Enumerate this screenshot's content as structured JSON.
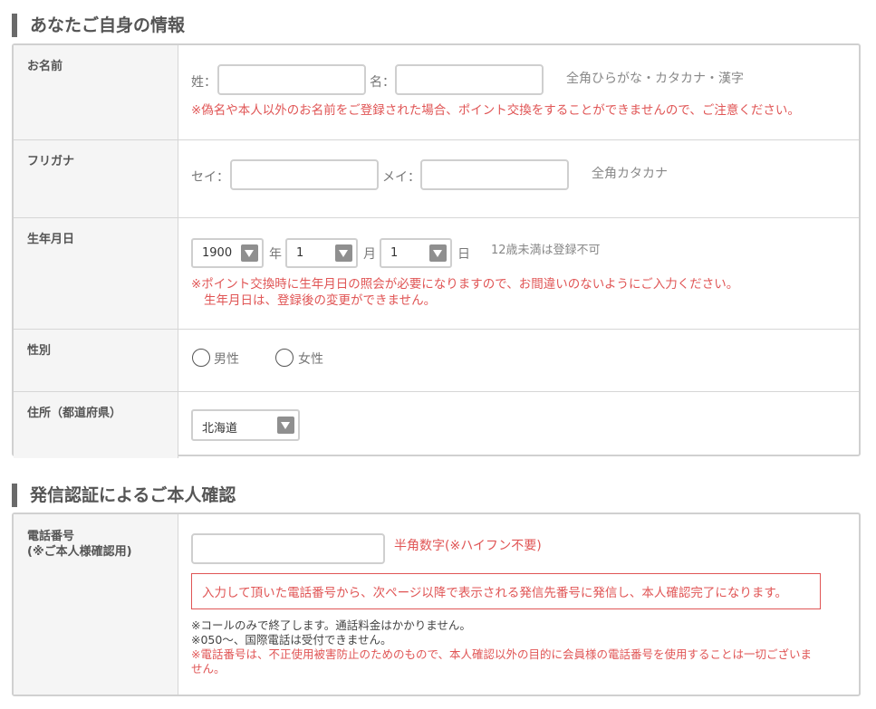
{
  "section1": {
    "title": "あなたご自身の情報",
    "name": {
      "label": "お名前",
      "last_label": "姓：",
      "first_label": "名：",
      "last_value": "",
      "first_value": "",
      "hint": "全角ひらがな・カタカナ・漢字",
      "warning": "※偽名や本人以外のお名前をご登録された場合、ポイント交換をすることができませんので、ご注意ください。"
    },
    "furigana": {
      "label": "フリガナ",
      "last_label": "セイ：",
      "first_label": "メイ：",
      "last_value": "",
      "first_value": "",
      "hint": "全角カタカナ"
    },
    "birthdate": {
      "label": "生年月日",
      "year": "1900",
      "year_unit": "年",
      "month": "1",
      "month_unit": "月",
      "day": "1",
      "day_unit": "日",
      "hint": "12歳未満は登録不可",
      "warning_line1": "※ポイント交換時に生年月日の照会が必要になりますので、お間違いのないようにご入力ください。",
      "warning_line2": "生年月日は、登録後の変更ができません。"
    },
    "gender": {
      "label": "性別",
      "male": "男性",
      "female": "女性"
    },
    "prefecture": {
      "label": "住所（都道府県）",
      "value": "北海道"
    }
  },
  "section2": {
    "title": "発信認証によるご本人確認",
    "phone": {
      "label_line1": "電話番号",
      "label_line2": "(※ご本人様確認用)",
      "value": "",
      "hint": "半角数字(※ハイフン不要)",
      "notice": "入力して頂いた電話番号から、次ページ以降で表示される発信先番号に発信し、本人確認完了になります。",
      "note1": "※コールのみで終了します。通話料金はかかりません。",
      "note2": "※050～、国際電話は受付できません。",
      "note3_line1": "※電話番号は、不正使用被害防止のためのもので、本人確認以外の目的に会員様の電話番号を使用することは一切ございま",
      "note3_line2": "せん。"
    }
  },
  "colors": {
    "warning": "#e05555",
    "title_bar": "#6a6a6a",
    "label_bg": "#f5f5f5"
  }
}
